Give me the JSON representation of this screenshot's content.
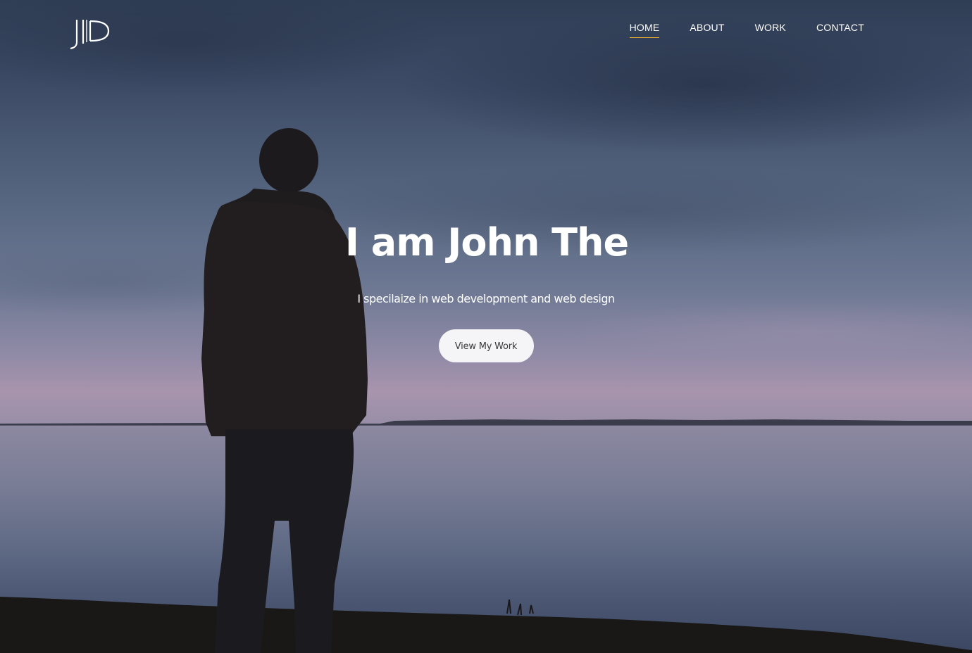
{
  "brand": {
    "logo_text": "JD"
  },
  "nav": {
    "items": [
      {
        "label": "HOME",
        "active": true
      },
      {
        "label": "ABOUT",
        "active": false
      },
      {
        "label": "WORK",
        "active": false
      },
      {
        "label": "CONTACT",
        "active": false
      }
    ]
  },
  "hero": {
    "title": "I am John The",
    "subtitle": "I specilaize in web development and web design",
    "cta_label": "View My Work"
  },
  "colors": {
    "active_underline": "#f1b62e",
    "button_bg": "#f5f4f6",
    "text": "#ffffff"
  }
}
